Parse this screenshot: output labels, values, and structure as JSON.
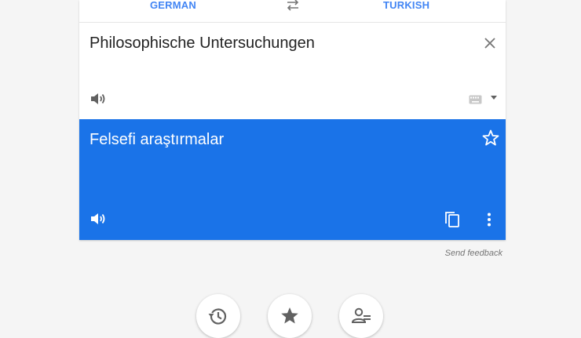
{
  "languages": {
    "source": "GERMAN",
    "target": "TURKISH"
  },
  "input": {
    "text": "Philosophische Untersuchungen"
  },
  "output": {
    "text": "Felsefi araştırmalar"
  },
  "footer": {
    "feedback_label": "Send feedback"
  },
  "colors": {
    "accent": "#4285f4",
    "result_background": "#1a73e8",
    "page_background": "#f5f5f5"
  },
  "icons": [
    "swap-languages-icon",
    "clear-icon",
    "speaker-icon",
    "keyboard-icon",
    "dropdown-caret-icon",
    "star-icon",
    "copy-icon",
    "more-vert-icon",
    "history-icon",
    "saved-star-icon",
    "community-icon"
  ]
}
